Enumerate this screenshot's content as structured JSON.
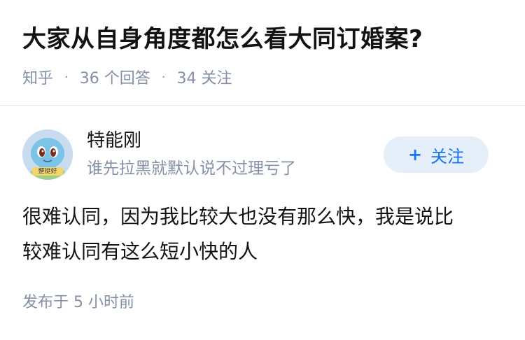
{
  "question": {
    "title": "大家从自身角度都怎么看大同订婚案?",
    "source": "知乎",
    "separator": "·",
    "answer_count": "36 个回答",
    "follower_count": "34 关注"
  },
  "answer": {
    "author": {
      "name": "特能刚",
      "bio": "谁先拉黑就默认说不过理亏了",
      "avatar_badge": "整挺好",
      "avatar_icon": "squirtle-avatar"
    },
    "follow_button": {
      "icon": "+",
      "label": "关注"
    },
    "content_lines": [
      "很难认同，因为我比较大也没有那么快，我是说比",
      "较难认同有这么短小快的人"
    ],
    "publish_time": "发布于 5 小时前"
  },
  "colors": {
    "meta_gray": "#8590a6",
    "accent_blue": "#1772f6",
    "follow_bg": "#e5effa"
  }
}
